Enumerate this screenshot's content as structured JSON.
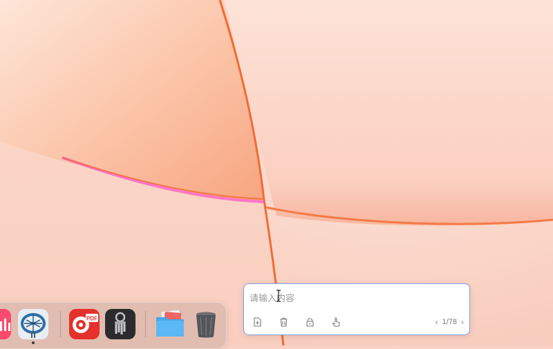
{
  "dock": {
    "apps": [
      {
        "name": "music-app-icon"
      },
      {
        "name": "mind-map-brain-app-icon"
      },
      {
        "name": "pdf-expert-app-icon"
      },
      {
        "name": "keychain-access-app-icon"
      },
      {
        "name": "downloads-folder-icon"
      },
      {
        "name": "trash-icon"
      }
    ],
    "pdf_label": "PDF"
  },
  "note_panel": {
    "input_placeholder": "请输入内容",
    "input_value": "",
    "toolbar": [
      "add-file-icon",
      "trash-icon",
      "lock-icon",
      "hand-pointer-icon"
    ],
    "pager": {
      "current": "1",
      "total": "78",
      "text": "1/78"
    }
  },
  "colors": {
    "accent_border": "#7f9de3",
    "wallpaper_base": "#f9d2c3",
    "wallpaper_orange": "#f36a33",
    "wallpaper_magenta": "#ff57c9"
  }
}
